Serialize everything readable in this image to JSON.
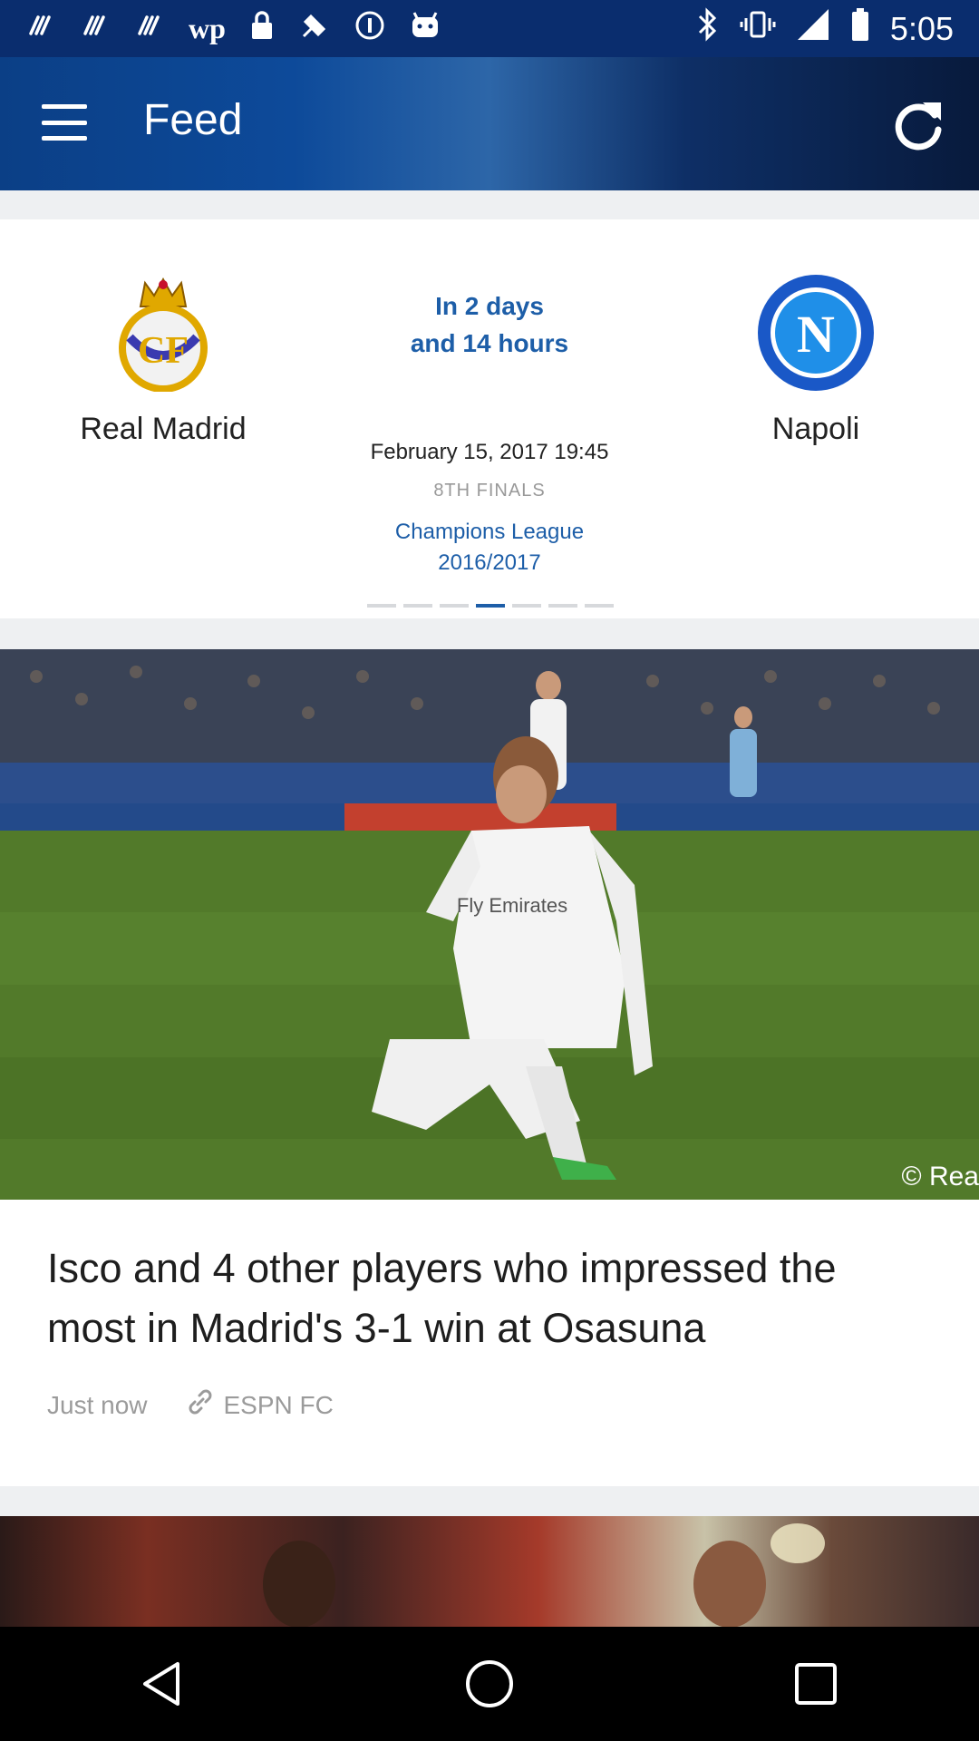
{
  "status_bar": {
    "time": "5:05",
    "left_icons": [
      "fitness-icon",
      "fitness-icon",
      "fitness-icon",
      "wp-icon",
      "lock-icon",
      "gps-icon",
      "circle-pause-icon",
      "android-icon"
    ],
    "wp_label": "wp",
    "right_icons": [
      "bluetooth-icon",
      "vibrate-icon",
      "signal-icon",
      "battery-icon"
    ]
  },
  "app_bar": {
    "title": "Feed",
    "menu_icon": "hamburger-menu-icon",
    "refresh_icon": "refresh-icon"
  },
  "match": {
    "home_team": "Real Madrid",
    "away_team": "Napoli",
    "away_logo_letter": "N",
    "countdown_line1": "In 2 days",
    "countdown_line2": "and 14 hours",
    "date": "February 15, 2017  19:45",
    "round": "8TH FINALS",
    "competition_line1": "Champions League",
    "competition_line2": "2016/2017",
    "pager_total": 7,
    "pager_active": 4
  },
  "article": {
    "title": "Isco and 4 other players who impressed the most in Madrid's 3-1 win at Osasuna",
    "time": "Just now",
    "source": "ESPN FC",
    "image_credit": "© Rea",
    "image_text": "Fly Emirates"
  },
  "colors": {
    "accent": "#1d5ea8",
    "status_bar": "#0a2d6e"
  }
}
